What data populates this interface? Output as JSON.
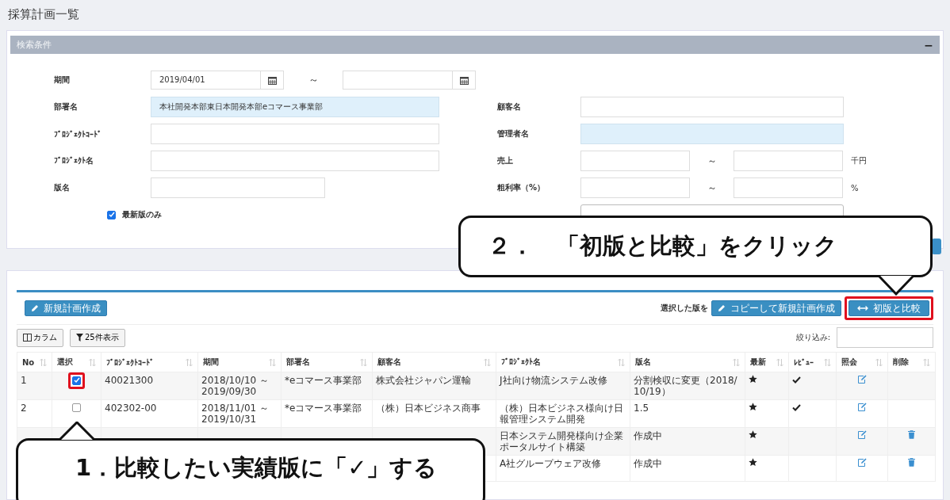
{
  "title": "採算計画一覧",
  "search": {
    "header": "検索条件",
    "collapse": "−",
    "left": [
      {
        "kind": "daterange",
        "label": "期間",
        "from": "2019/04/01",
        "sep": "～"
      },
      {
        "kind": "text",
        "label": "部署名",
        "value": "本社開発本部東日本開発本部eコマース事業部",
        "readonly": true
      },
      {
        "kind": "text",
        "label": "ﾌﾟﾛｼﾞｪｸﾄｺｰﾄﾞ",
        "readonly": false
      },
      {
        "kind": "text",
        "label": "ﾌﾟﾛｼﾞｪｸﾄ名",
        "readonly": false
      },
      {
        "kind": "short",
        "label": "版名"
      },
      {
        "kind": "checkbox",
        "label": "最新版のみ",
        "checked": true
      }
    ],
    "right": [
      {
        "kind": "text",
        "label": "顧客名",
        "readonly": false
      },
      {
        "kind": "text",
        "label": "管理者名",
        "readonly": true
      },
      {
        "kind": "range",
        "label": "売上",
        "sep": "～",
        "unit": "千円"
      },
      {
        "kind": "range",
        "label": "粗利率（%）",
        "sep": "～",
        "unit": "%"
      },
      {
        "kind": "select"
      }
    ]
  },
  "toolbar": {
    "new": "新規計画作成",
    "selected_label": "選択した版を",
    "copy": "コピーして新規計画作成",
    "compare": {
      "label": "初版と比較",
      "highlighted": true
    },
    "columns": "カラム",
    "page_size": "25件表示",
    "filter_label": "絞り込み:"
  },
  "table": {
    "columns": [
      "No",
      "選択",
      "ﾌﾟﾛｼﾞｪｸﾄｺｰﾄﾞ",
      "期間",
      "部署名",
      "顧客名",
      "ﾌﾟﾛｼﾞｪｸﾄ名",
      "版名",
      "最新",
      "ﾚﾋﾞｭｰ",
      "照会",
      "削除"
    ],
    "rows": [
      {
        "no": "1",
        "checked": true,
        "highlighted": true,
        "code": "40021300",
        "period": "2018/10/10 ～ 2019/09/30",
        "dept": "*eコマース事業部",
        "customer": "株式会社ジャパン運輸",
        "project": "J社向け物流システム改修",
        "version": "分割検収に変更（2018/10/19）",
        "latest": true,
        "reviewed": true,
        "deletable": false
      },
      {
        "no": "2",
        "checked": false,
        "highlighted": false,
        "code": "402302-00",
        "period": "2018/11/01 ～ 2019/10/31",
        "dept": "*eコマース事業部",
        "customer": "（株）日本ビジネス商事",
        "project": "（株）日本ビジネス様向け日報管理システム開発",
        "version": "1.5",
        "latest": true,
        "reviewed": true,
        "deletable": false
      },
      {
        "project": "日本システム開発様向け企業ポータルサイト構築",
        "version": "作成中",
        "latest": true,
        "reviewed": false,
        "deletable": true
      },
      {
        "project": "A社グループウェア改修",
        "version": "作成中",
        "latest": true,
        "reviewed": false,
        "deletable": true
      }
    ]
  },
  "callouts": [
    {
      "text": "２．　「初版と比較」をクリック"
    },
    {
      "text": "1．比較したい実績版に「✓」する"
    }
  ]
}
